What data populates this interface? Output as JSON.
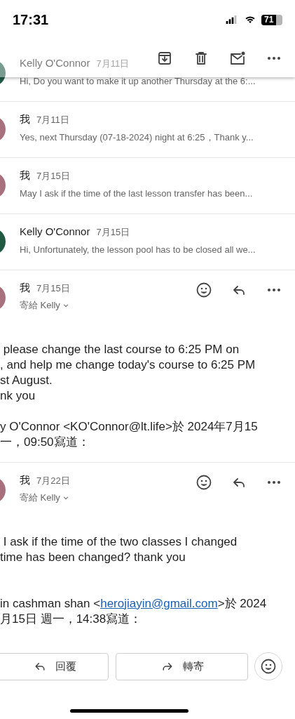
{
  "status_bar": {
    "time": "17:31",
    "battery": "71"
  },
  "collapsed_messages": [
    {
      "sender": "Kelly O'Connor",
      "date": "7月11日",
      "snippet": "Hi, Do you want to make it up another Thursday at the 6:...",
      "color": "#1f5a45"
    },
    {
      "sender": "我",
      "date": "7月11日",
      "snippet": "Yes, next Thursday (07-18-2024) night at 6:25，Thank y...",
      "color": "#a86f7c"
    },
    {
      "sender": "我",
      "date": "7月15日",
      "snippet": "May I ask if the time of the last lesson transfer has been...",
      "color": "#a86f7c"
    },
    {
      "sender": "Kelly O'Connor",
      "date": "7月15日",
      "snippet": "Hi, Unfortunately, the lesson pool has to be closed all we...",
      "color": "#1f5a45"
    }
  ],
  "expanded_messages": [
    {
      "sender": "我",
      "date": "7月15日",
      "recipient": "寄給 Kelly",
      "color": "#a86f7c",
      "body_lines": [
        " please change the last course to 6:25 PM on",
        ", and help me change today's course to 6:25 PM",
        "st August.",
        "nk you"
      ],
      "quote_lines": [
        [
          {
            "kind": "text",
            "text": "y O'Connor <KO'Connor@lt.life>於 2024年7月15"
          }
        ],
        [
          {
            "kind": "text",
            "text": "一，09:50寫道："
          }
        ]
      ]
    },
    {
      "sender": "我",
      "date": "7月22日",
      "recipient": "寄給 Kelly",
      "color": "#a86f7c",
      "body_lines": [
        " I ask if the time of the two classes I changed",
        "time has been changed? thank you"
      ],
      "quote_lines": [
        [
          {
            "kind": "text",
            "text": "in cashman shan <"
          },
          {
            "kind": "link",
            "text": "herojiayin@gmail.com"
          },
          {
            "kind": "text",
            "text": ">於 2024"
          }
        ],
        [
          {
            "kind": "text",
            "text": "月15日 週一，14:38寫道："
          }
        ]
      ]
    }
  ],
  "footer_buttons": [
    {
      "kind": "reply",
      "label": "回覆"
    },
    {
      "kind": "forward",
      "label": "轉寄"
    }
  ]
}
